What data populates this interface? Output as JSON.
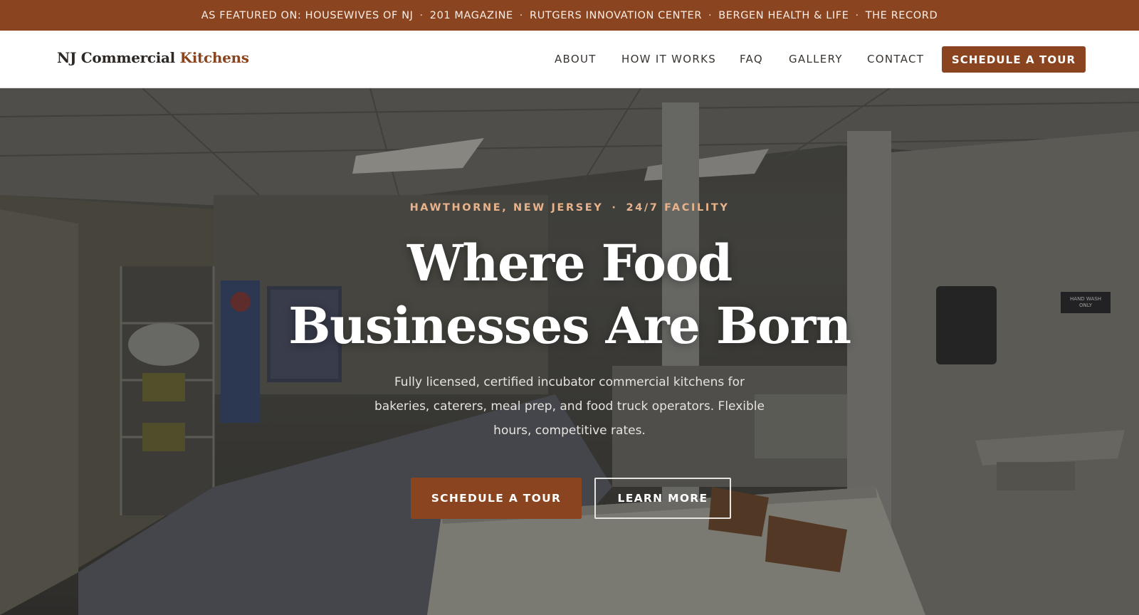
{
  "featured_bar": {
    "items": [
      "AS FEATURED ON: HOUSEWIVES OF NJ",
      "201 MAGAZINE",
      "RUTGERS INNOVATION CENTER",
      "BERGEN HEALTH & LIFE",
      "THE RECORD"
    ],
    "separator": "·"
  },
  "nav": {
    "logo_main": "NJ Commercial",
    "logo_accent": "Kitchens",
    "links": [
      "ABOUT",
      "HOW IT WORKS",
      "FAQ",
      "GALLERY",
      "CONTACT"
    ],
    "cta_label": "SCHEDULE A TOUR"
  },
  "hero": {
    "eyebrow_location": "HAWTHORNE, NEW JERSEY",
    "eyebrow_separator": "·",
    "eyebrow_hours": "24/7 FACILITY",
    "headline_line1": "Where Food",
    "headline_line2": "Businesses Are Born",
    "subheading": "Fully licensed, certified incubator commercial kitchens for bakeries, caterers, meal prep, and food truck operators. Flexible hours, competitive rates.",
    "primary_button": "SCHEDULE A TOUR",
    "secondary_button": "LEARN MORE",
    "image_signs": [
      "HAND WASH ONLY"
    ]
  },
  "colors": {
    "brand": "#8a4420",
    "eyebrow": "#e8b38c",
    "nav_text": "#3a3430",
    "logo_text": "#2d2824"
  }
}
